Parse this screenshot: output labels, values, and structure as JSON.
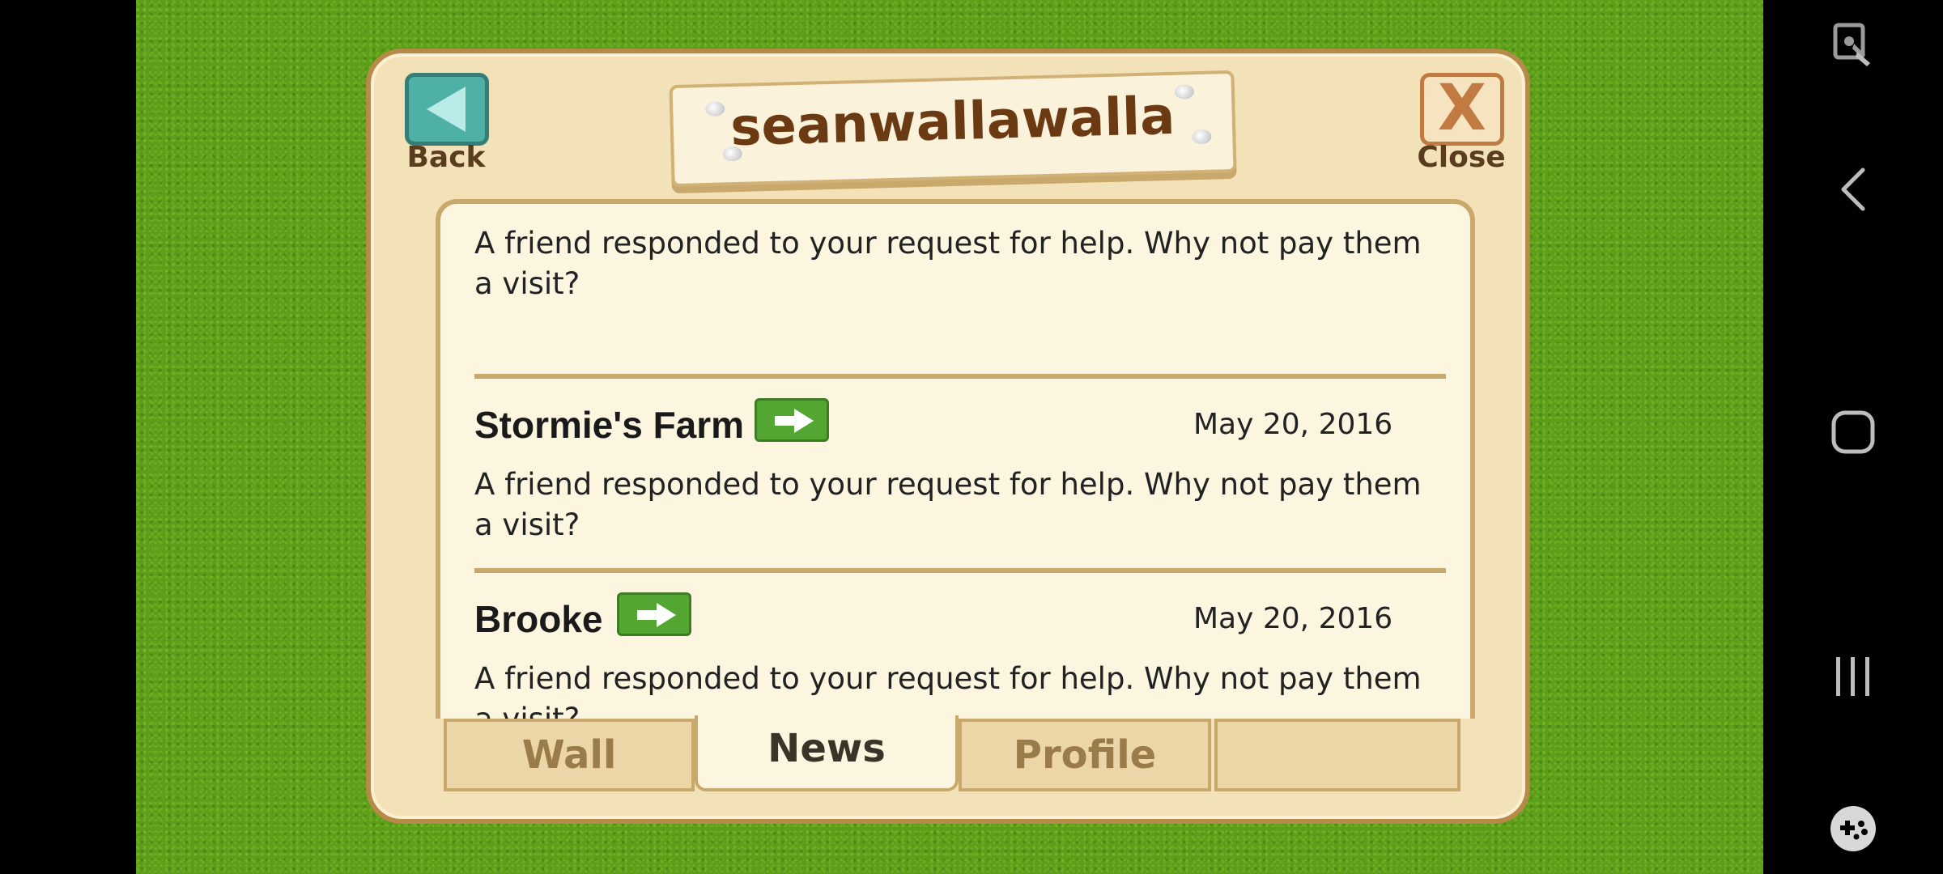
{
  "header": {
    "title": "seanwallawalla",
    "back_label": "Back",
    "close_label": "Close"
  },
  "feed": {
    "items": [
      {
        "name": "",
        "date": "",
        "text": "A friend responded to your request for help. Why not pay them a visit?"
      },
      {
        "name": "Stormie's Farm",
        "date": "May 20, 2016",
        "text": "A friend responded to your request for help. Why not pay them a visit?"
      },
      {
        "name": "Brooke",
        "date": "May 20, 2016",
        "text": "A friend responded to your request for help. Why not pay them a visit?"
      }
    ]
  },
  "tabs": [
    {
      "label": "Wall",
      "active": false
    },
    {
      "label": "News",
      "active": true
    },
    {
      "label": "Profile",
      "active": false
    },
    {
      "label": "",
      "active": false
    }
  ],
  "icons": {
    "back": "back-arrow-icon",
    "close": "close-x-icon",
    "visit": "arrow-right-icon",
    "nav_back": "chevron-left-icon",
    "nav_home": "home-square-icon",
    "nav_recents": "recents-bars-icon",
    "game_tools": "gamepad-icon",
    "screen_lock": "touch-lock-icon"
  },
  "colors": {
    "grass": "#5a9e1a",
    "panel": "#f3e2b8",
    "accent_teal": "#4fb0a6",
    "visit_green": "#54a632",
    "title_brown": "#6b3a12"
  }
}
